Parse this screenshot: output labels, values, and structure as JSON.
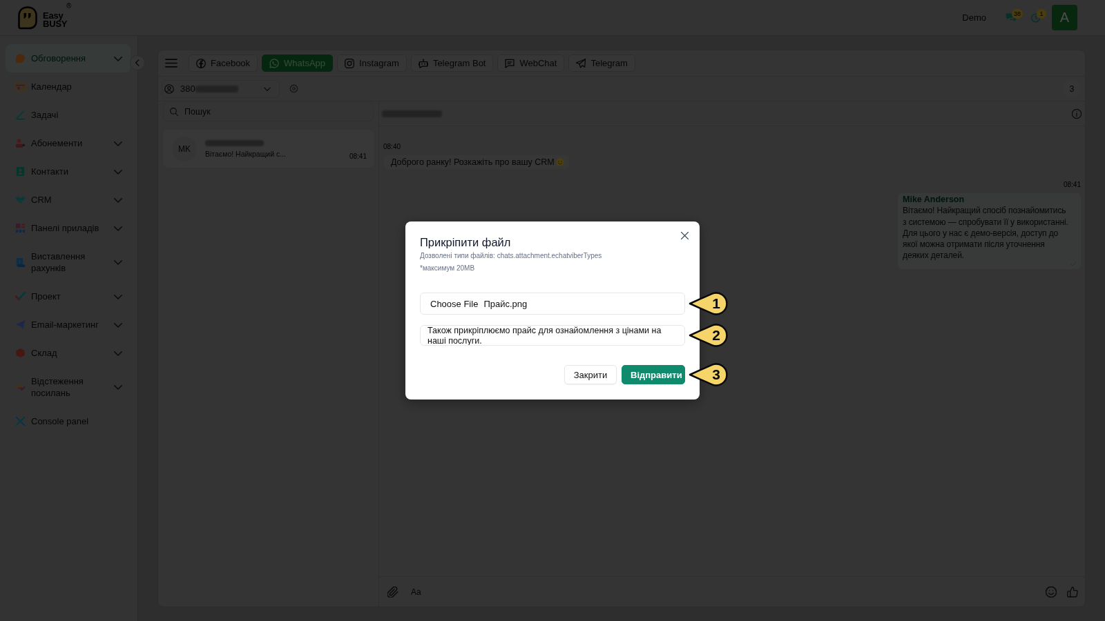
{
  "header": {
    "logo": {
      "line_1": "Easy",
      "line_2": "BUSY",
      "mark": "®"
    },
    "mode_label": "Demo",
    "notifications": [
      {
        "kind": "chat",
        "count": "38"
      },
      {
        "kind": "timer",
        "count": "1"
      }
    ],
    "avatar": "A"
  },
  "sidebar": {
    "items": [
      {
        "label": "Обговорення",
        "selected": true,
        "has_submenu": true
      },
      {
        "label": "Календар",
        "selected": false,
        "has_submenu": false
      },
      {
        "label": "Задачі",
        "selected": false,
        "has_submenu": false
      },
      {
        "label": "Абонементи",
        "selected": false,
        "has_submenu": true
      },
      {
        "label": "Контакти",
        "selected": false,
        "has_submenu": true
      },
      {
        "label": "CRM",
        "selected": false,
        "has_submenu": true
      },
      {
        "label": "Панелі приладів",
        "selected": false,
        "has_submenu": true
      },
      {
        "label": "Виставлення рахунків",
        "selected": false,
        "has_submenu": true
      },
      {
        "label": "Проект",
        "selected": false,
        "has_submenu": true
      },
      {
        "label": "Email-маркетинг",
        "selected": false,
        "has_submenu": true
      },
      {
        "label": "Склад",
        "selected": false,
        "has_submenu": true
      },
      {
        "label": "Відстеження посилань",
        "selected": false,
        "has_submenu": true
      },
      {
        "label": "Console panel",
        "selected": false,
        "has_submenu": false
      }
    ]
  },
  "channel_tabs": [
    {
      "label": "Facebook",
      "selected": false
    },
    {
      "label": "WhatsApp",
      "selected": true
    },
    {
      "label": "Instagram",
      "selected": false
    },
    {
      "label": "Telegram Bot",
      "selected": false
    },
    {
      "label": "WebChat",
      "selected": false
    },
    {
      "label": "Telegram",
      "selected": false
    }
  ],
  "account_selector": {
    "value": "380",
    "redacted": true
  },
  "counter": "3",
  "chat_list": {
    "search": {
      "placeholder": "Пошук"
    },
    "chats": [
      {
        "initials": "MK",
        "name_redacted": true,
        "preview": "Вітаємо! Найкращий с...",
        "time": "08:41"
      }
    ]
  },
  "conversation": {
    "title_redacted": true,
    "messages": [
      {
        "kind": "incoming",
        "time": "08:40",
        "text": "Доброго ранку! Розкажіть про вашу CRM",
        "emoji": true
      },
      {
        "kind": "outgoing",
        "time": "08:41",
        "sender": "Mike Anderson",
        "text": "Вітаємо! Найкращий спосіб познайомитись з системою — спробувати її у використанні. Для цього у нас є демо-версія, доступ до якої можна отримати після уточнення деяких деталей.",
        "delivered": true
      }
    ],
    "composer": {
      "placeholder": "Aa"
    }
  },
  "dialog": {
    "title": "Прикріпити файл",
    "notes": [
      "Дозволені типи файлів: chats.attachment.echatviberTypes",
      "*максимум 20MB"
    ],
    "file_input": {
      "button": "Choose File",
      "file_name": "Прайс.png"
    },
    "message": {
      "value": "Також прикріплюємо прайс для ознайомлення з цінами на наші послуги."
    },
    "buttons": [
      {
        "label": "Закрити",
        "kind": "secondary"
      },
      {
        "label": "Відправити",
        "kind": "primary"
      }
    ]
  },
  "callouts": [
    {
      "label": "1"
    },
    {
      "label": "2"
    },
    {
      "label": "3"
    }
  ]
}
